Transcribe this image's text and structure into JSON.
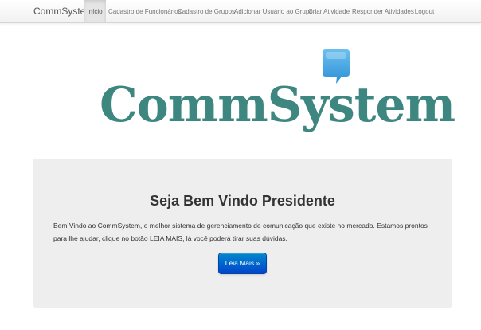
{
  "navbar": {
    "brand": "CommSystem",
    "items": [
      {
        "label": "Início",
        "active": true
      },
      {
        "label": "Cadastro de Funcionários",
        "active": false
      },
      {
        "label": "Cadastro de Grupos",
        "active": false
      },
      {
        "label": "Adicionar Usuário ao Grupo",
        "active": false
      },
      {
        "label": "Criar Atividade",
        "active": false
      },
      {
        "label": "Responder Atividades",
        "active": false
      },
      {
        "label": "Logout",
        "active": false
      }
    ]
  },
  "logo": {
    "text": "CommSystem",
    "icon": "speech-bubble-icon",
    "text_color": "#3e8781",
    "bubble_color": "#3ea0de"
  },
  "hero": {
    "title": "Seja Bem Vindo Presidente",
    "text": "Bem Vindo ao CommSystem, o melhor sistema de gerenciamento de comunicação que existe no mercado. Estamos prontos para lhe ajudar, clique no botão LEIA MAIS, lá você poderá tirar suas dúvidas.",
    "button_label": "Leia Mais »",
    "button_color": "#0066cc"
  }
}
